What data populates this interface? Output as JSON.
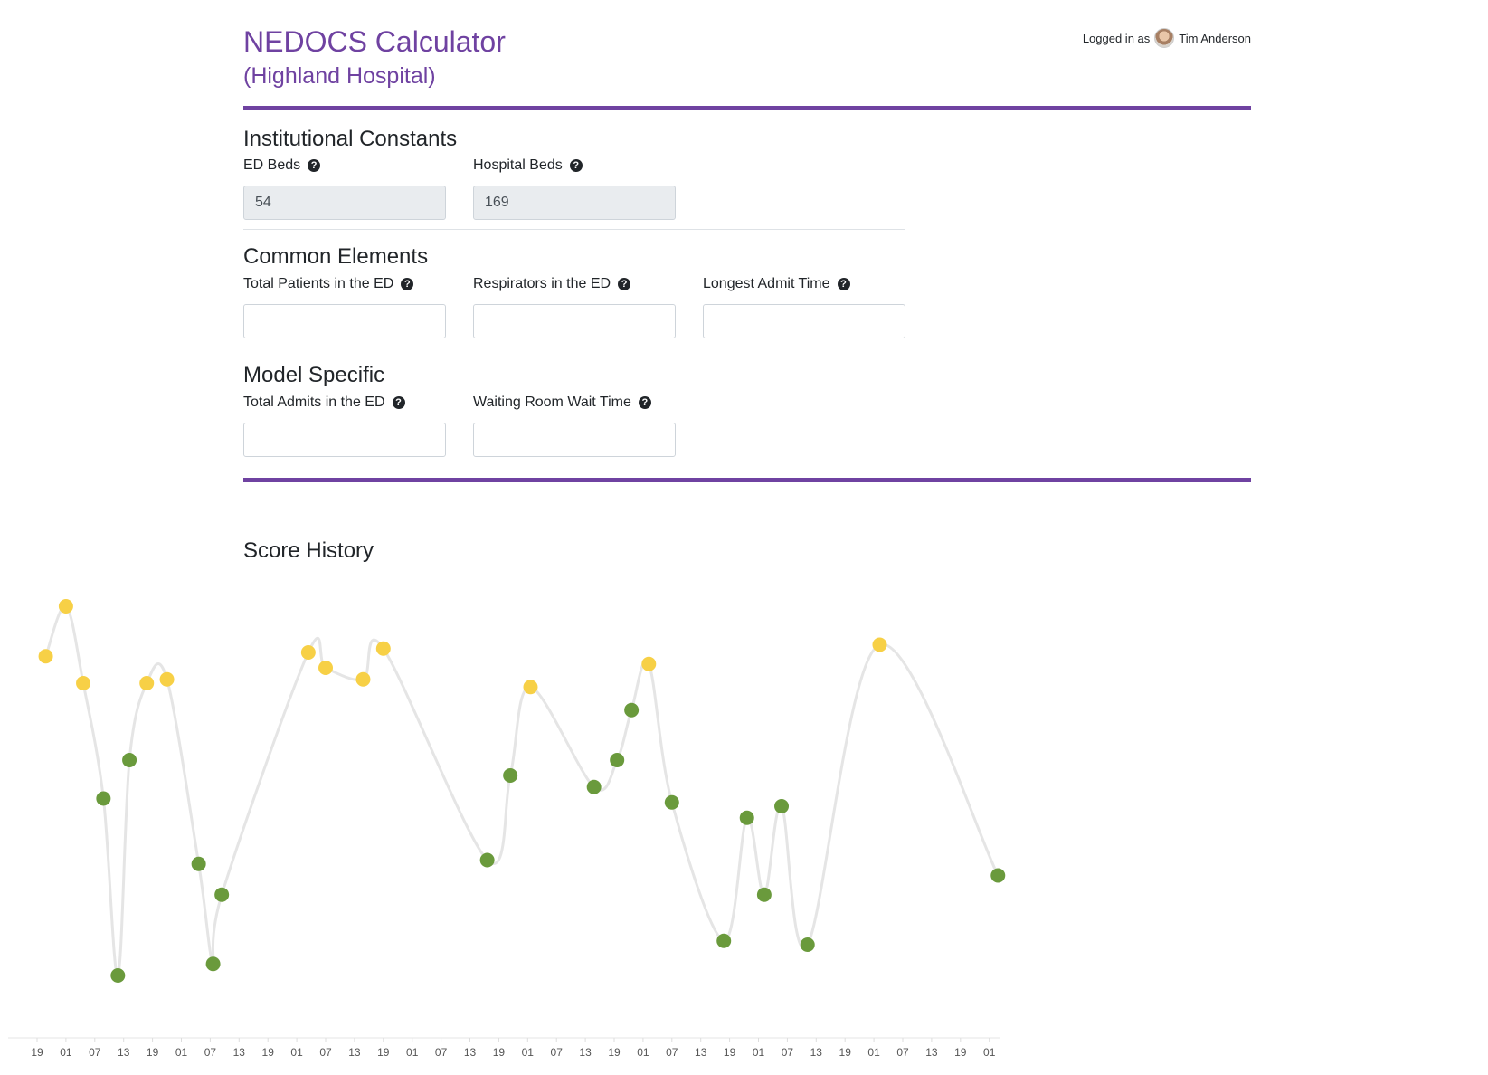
{
  "header": {
    "title": "NEDOCS Calculator",
    "subtitle": "(Highland Hospital)",
    "logged_in_label": "Logged in as",
    "user_name": "Tim Anderson"
  },
  "institutional": {
    "heading": "Institutional Constants",
    "ed_beds": {
      "label": "ED Beds",
      "value": "54"
    },
    "hospital_beds": {
      "label": "Hospital Beds",
      "value": "169"
    }
  },
  "common": {
    "heading": "Common Elements",
    "total_patients": {
      "label": "Total Patients in the ED",
      "value": ""
    },
    "respirators": {
      "label": "Respirators in the ED",
      "value": ""
    },
    "longest_admit": {
      "label": "Longest Admit Time",
      "value": ""
    }
  },
  "model": {
    "heading": "Model Specific",
    "total_admits": {
      "label": "Total Admits in the ED",
      "value": ""
    },
    "waiting_room": {
      "label": "Waiting Room Wait Time",
      "value": ""
    }
  },
  "score_history": {
    "heading": "Score History"
  },
  "colors": {
    "accent": "#6f42a1",
    "yellow_point": "#f7d046",
    "green_point": "#6a9a3c",
    "line": "#e5e5e5"
  },
  "chart_data": {
    "type": "line",
    "x_tick_labels": [
      "19",
      "01",
      "07",
      "13",
      "19",
      "01",
      "07",
      "13",
      "19",
      "01",
      "07",
      "13",
      "19",
      "01",
      "07",
      "13",
      "19",
      "01",
      "07",
      "13",
      "19",
      "01",
      "07",
      "13",
      "19",
      "01",
      "07",
      "13",
      "19",
      "01",
      "07",
      "13",
      "19",
      "01"
    ],
    "series": [
      {
        "values": [
          {
            "x": 0.3,
            "y": 0.87,
            "level": "yellow"
          },
          {
            "x": 1.0,
            "y": 1.0,
            "level": "yellow"
          },
          {
            "x": 1.6,
            "y": 0.8,
            "level": "yellow"
          },
          {
            "x": 2.3,
            "y": 0.5,
            "level": "green"
          },
          {
            "x": 2.8,
            "y": 0.04,
            "level": "green"
          },
          {
            "x": 3.2,
            "y": 0.6,
            "level": "green"
          },
          {
            "x": 3.8,
            "y": 0.8,
            "level": "yellow"
          },
          {
            "x": 4.5,
            "y": 0.81,
            "level": "yellow"
          },
          {
            "x": 5.6,
            "y": 0.33,
            "level": "green"
          },
          {
            "x": 6.1,
            "y": 0.07,
            "level": "green"
          },
          {
            "x": 6.4,
            "y": 0.25,
            "level": "green"
          },
          {
            "x": 9.4,
            "y": 0.88,
            "level": "yellow"
          },
          {
            "x": 10.0,
            "y": 0.84,
            "level": "yellow"
          },
          {
            "x": 11.3,
            "y": 0.81,
            "level": "yellow"
          },
          {
            "x": 12.0,
            "y": 0.89,
            "level": "yellow"
          },
          {
            "x": 15.6,
            "y": 0.34,
            "level": "green"
          },
          {
            "x": 16.4,
            "y": 0.56,
            "level": "green"
          },
          {
            "x": 17.1,
            "y": 0.79,
            "level": "yellow"
          },
          {
            "x": 19.3,
            "y": 0.53,
            "level": "green"
          },
          {
            "x": 20.1,
            "y": 0.6,
            "level": "green"
          },
          {
            "x": 20.6,
            "y": 0.73,
            "level": "green"
          },
          {
            "x": 21.2,
            "y": 0.85,
            "level": "yellow"
          },
          {
            "x": 22.0,
            "y": 0.49,
            "level": "green"
          },
          {
            "x": 23.8,
            "y": 0.13,
            "level": "green"
          },
          {
            "x": 24.6,
            "y": 0.45,
            "level": "green"
          },
          {
            "x": 25.2,
            "y": 0.25,
            "level": "green"
          },
          {
            "x": 25.8,
            "y": 0.48,
            "level": "green"
          },
          {
            "x": 26.7,
            "y": 0.12,
            "level": "green"
          },
          {
            "x": 29.2,
            "y": 0.9,
            "level": "yellow"
          },
          {
            "x": 33.3,
            "y": 0.3,
            "level": "green"
          }
        ]
      }
    ],
    "grid": false,
    "legend": "none"
  }
}
